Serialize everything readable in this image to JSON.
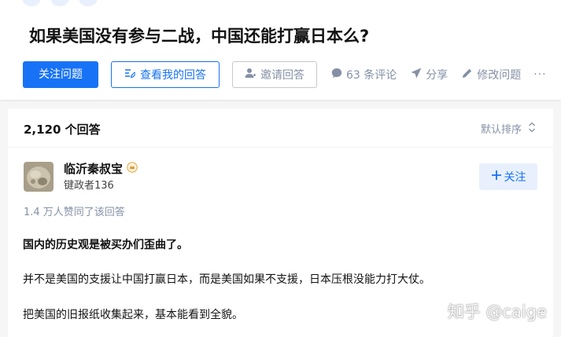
{
  "question": {
    "topics": [
      "",
      "",
      ""
    ],
    "title": "如果美国没有参与二战，中国还能打赢日本么?",
    "actions": {
      "follow": "关注问题",
      "view_my_answer": "查看我的回答",
      "invite": "邀请回答",
      "comments": "63 条评论",
      "share": "分享",
      "edit": "修改问题",
      "more": "···"
    }
  },
  "answers": {
    "count": "2,120 个回答",
    "sort": "默认排序"
  },
  "answer": {
    "author_name": "临沂秦叔宝",
    "author_bio": "键政者136",
    "follow_label": "关注",
    "vote_summary": "1.4 万人赞同了该回答",
    "paragraphs": [
      "国内的历史观是被买办们歪曲了。",
      "并不是美国的支援让中国打赢日本，而是美国如果不支援，日本压根没能力打大仗。",
      "把美国的旧报纸收集起来，基本能看到全貌。"
    ]
  },
  "watermark": "知乎 @caige",
  "colors": {
    "brand_blue": "#1772f6",
    "muted": "#8590a6",
    "blue_light": "#e8f0fd"
  },
  "icons": [
    "edit-icon",
    "invite-user-icon",
    "comment-icon",
    "share-icon",
    "pencil-icon",
    "sort-icon",
    "plus-icon",
    "badge-icon"
  ]
}
